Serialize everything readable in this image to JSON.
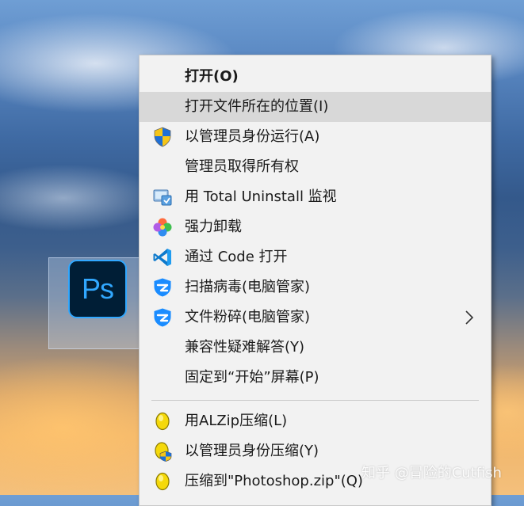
{
  "desktop_icon": {
    "logo_text": "Ps"
  },
  "menu": {
    "items": [
      {
        "label": "打开(O)",
        "icon": "none"
      },
      {
        "label": "打开文件所在的位置(I)",
        "icon": "none"
      },
      {
        "label": "以管理员身份运行(A)",
        "icon": "uac-shield-icon"
      },
      {
        "label": "管理员取得所有权",
        "icon": "none"
      },
      {
        "label": "用 Total Uninstall 监视",
        "icon": "total-uninstall-icon"
      },
      {
        "label": "强力卸载",
        "icon": "clover-icon"
      },
      {
        "label": "通过 Code 打开",
        "icon": "vscode-icon"
      },
      {
        "label": "扫描病毒(电脑管家)",
        "icon": "pc-manager-shield-icon"
      },
      {
        "label": "文件粉碎(电脑管家)",
        "icon": "pc-manager-shield-icon"
      },
      {
        "label": "兼容性疑难解答(Y)",
        "icon": "none"
      },
      {
        "label": "固定到“开始”屏幕(P)",
        "icon": "none"
      },
      {
        "label": "用ALZip压缩(L)",
        "icon": "alzip-icon"
      },
      {
        "label": "以管理员身份压缩(Y)",
        "icon": "alzip-admin-icon"
      },
      {
        "label": "压缩到\"Photoshop.zip\"(Q)",
        "icon": "alzip-icon"
      }
    ]
  },
  "watermark": {
    "text": "知乎 @冒险的Cutfish"
  },
  "colors": {
    "menu_bg": "#f2f2f2",
    "hover_bg": "#d8d8d8",
    "ps_bg": "#001e36",
    "ps_accent": "#31a8ff"
  }
}
